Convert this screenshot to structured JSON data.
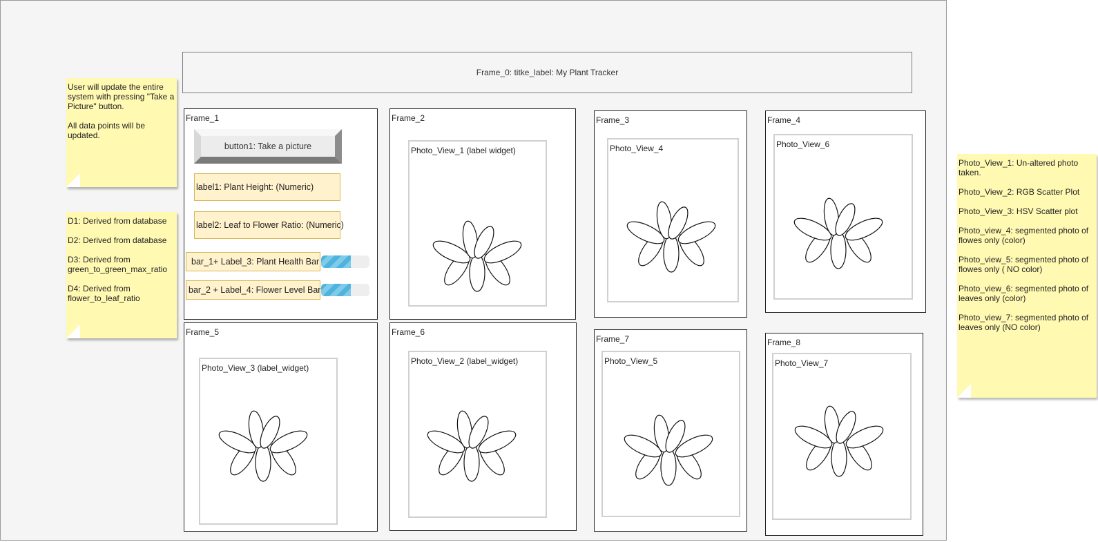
{
  "title": "Frame_0: titke_label: My Plant Tracker",
  "frames": {
    "f1": "Frame_1",
    "f2": "Frame_2",
    "f3": "Frame_3",
    "f4": "Frame_4",
    "f5": "Frame_5",
    "f6": "Frame_6",
    "f7": "Frame_7",
    "f8": "Frame_8"
  },
  "photos": {
    "p1": "Photo_View_1 (label widget)",
    "p4": "Photo_View_4",
    "p6": "Photo_View_6",
    "p3": "Photo_View_3 (label_widget)",
    "p2": "Photo_View_2 (label_widget)",
    "p5": "Photo_View_5",
    "p7": "Photo_View_7"
  },
  "controls": {
    "button1": "button1: Take a picture",
    "label1": "label1: Plant Height: (Numeric)",
    "label2": "label2: Leaf to Flower Ratio: (Numeric)",
    "label3": "bar_1+ Label_3: Plant Health Bar",
    "label4": "bar_2 + Label_4: Flower Level Bar",
    "bar1_level": 0.62,
    "bar2_level": 0.62
  },
  "notes": {
    "update": [
      "User will update the entire system with pressing \"Take a Picture\" button.",
      "All data points will be updated."
    ],
    "derived": [
      "D1: Derived from database",
      "D2: Derived from database",
      "D3: Derived from green_to_green_max_ratio",
      "D4: Derived from flower_to_leaf_ratio"
    ],
    "photos": [
      "Photo_View_1:  Un-altered photo taken.",
      "Photo_View_2: RGB Scatter Plot",
      "Photo_View_3: HSV Scatter plot",
      "Photo_view_4: segmented photo of flowes only (color)",
      "Photo_view_5: segmented photo of flowes only ( NO color)",
      "Photo_view_6: segmented photo of leaves only (color)",
      "Photo_view_7: segmented photo of leaves only (NO color)"
    ]
  },
  "colors": {
    "note": "#fff9b2",
    "label_fill": "#fff2cc",
    "label_border": "#d6b656",
    "bar_fill": "#4fb3dd"
  }
}
